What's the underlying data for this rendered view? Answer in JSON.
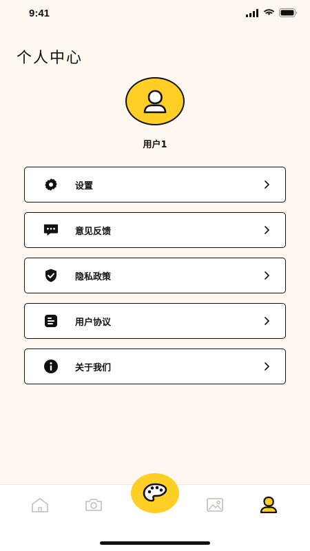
{
  "status_bar": {
    "time": "9:41"
  },
  "header": {
    "title": "个人中心"
  },
  "profile": {
    "username": "用户1",
    "avatar_color": "#FFCF26"
  },
  "menu": {
    "items": [
      {
        "label": "设置",
        "icon": "gear-icon"
      },
      {
        "label": "意见反馈",
        "icon": "chat-bubble-icon"
      },
      {
        "label": "隐私政策",
        "icon": "shield-check-icon"
      },
      {
        "label": "用户协议",
        "icon": "document-icon"
      },
      {
        "label": "关于我们",
        "icon": "info-icon"
      }
    ]
  },
  "tab_bar": {
    "tabs": [
      {
        "icon": "home-icon",
        "active": false
      },
      {
        "icon": "camera-icon",
        "active": false
      },
      {
        "icon": "palette-icon",
        "active": false
      },
      {
        "icon": "gallery-icon",
        "active": false
      },
      {
        "icon": "profile-icon",
        "active": true
      }
    ],
    "accent_color": "#FFCF26"
  }
}
